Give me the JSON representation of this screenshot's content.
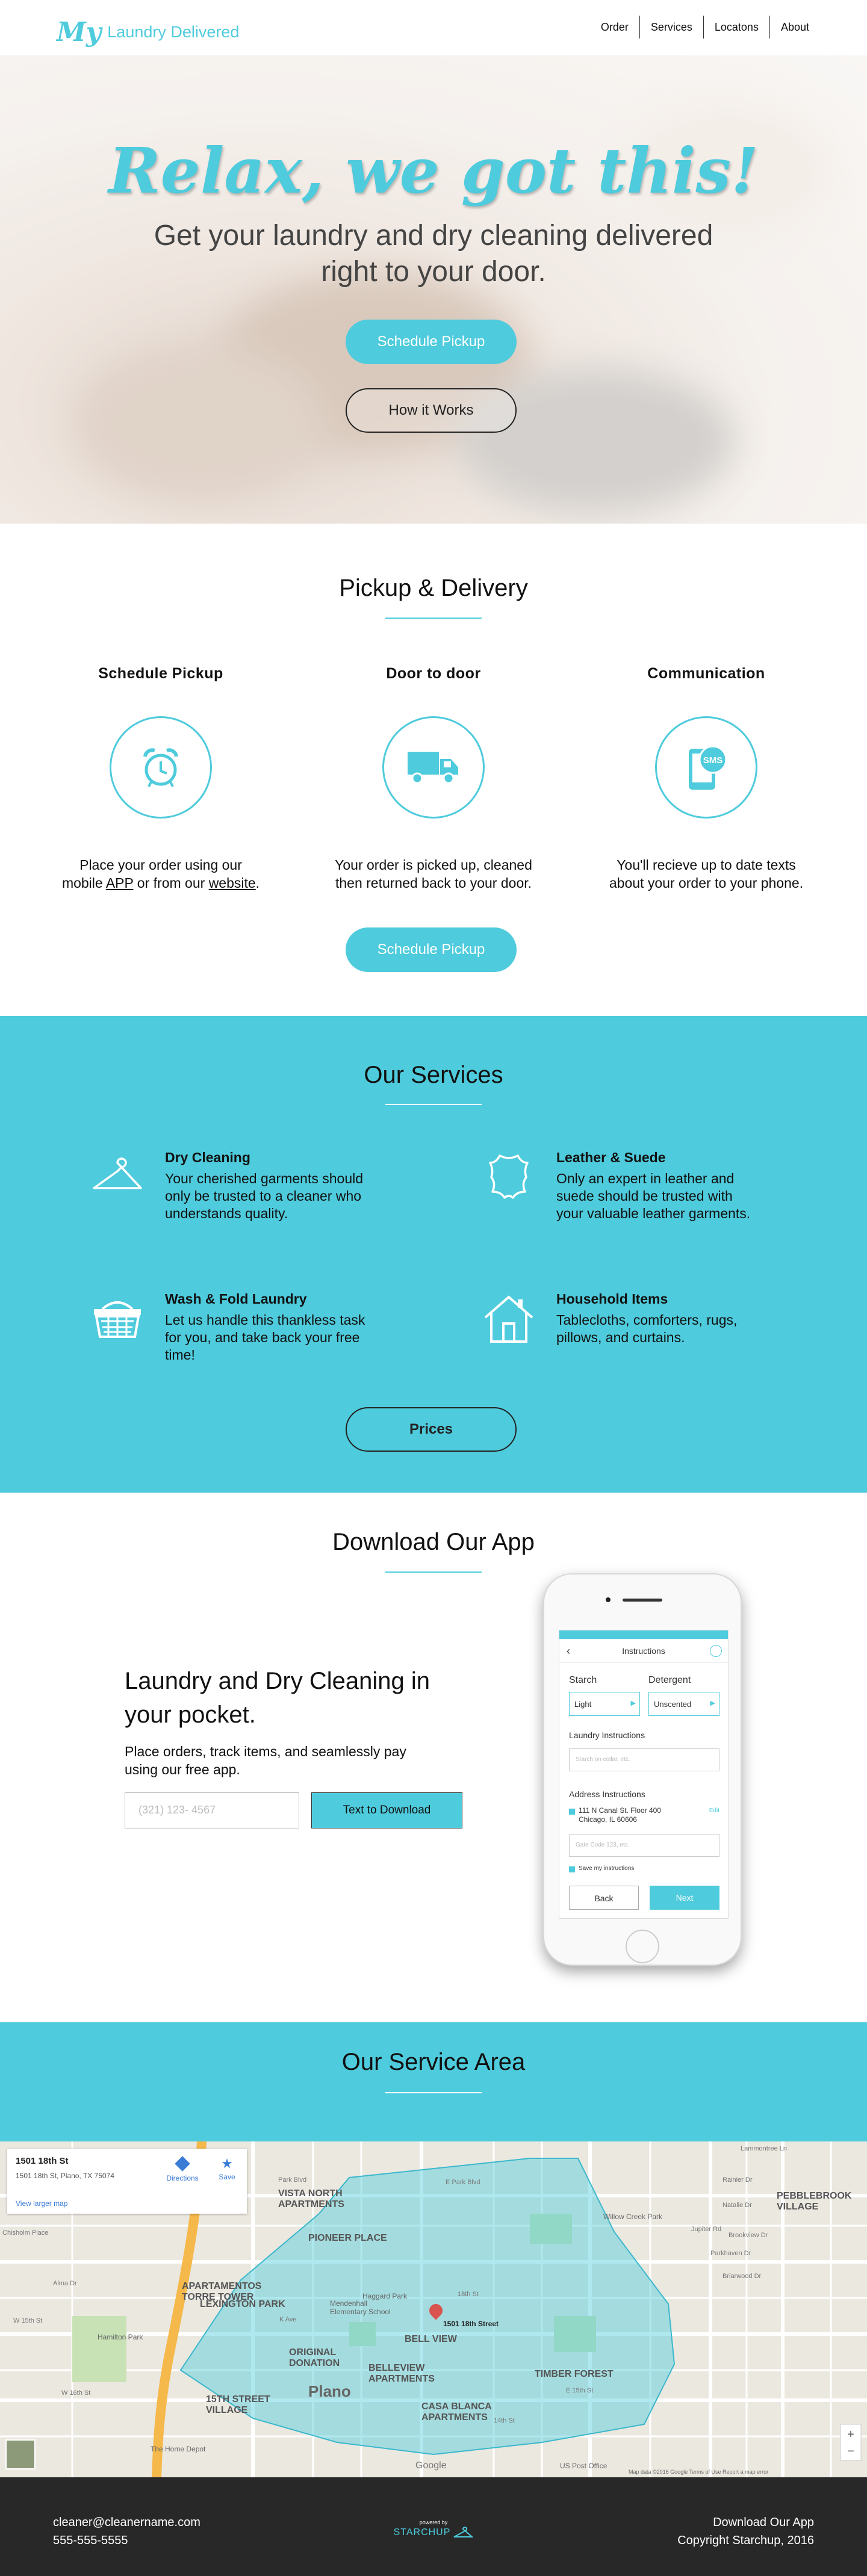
{
  "nav": {
    "logo_my": "My",
    "logo_text": "Laundry Delivered",
    "links": [
      "Order",
      "Services",
      "Locatons",
      "About"
    ]
  },
  "hero": {
    "title": "Relax, we got this!",
    "subtitle_line1": "Get your laundry and dry cleaning delivered",
    "subtitle_line2": "right to your door.",
    "primary_button": "Schedule Pickup",
    "secondary_button": "How it Works"
  },
  "pickup": {
    "title": "Pickup & Delivery",
    "columns": [
      {
        "heading": "Schedule Pickup",
        "icon": "alarm-clock-icon",
        "text_a": "Place your order using our",
        "text_b": "mobile ",
        "link1": "APP",
        "text_c": " or from our ",
        "link2": "website",
        "text_d": "."
      },
      {
        "heading": "Door to door",
        "icon": "delivery-truck-icon",
        "text1": "Your order is picked up, cleaned",
        "text2": "then returned back to your door."
      },
      {
        "heading": "Communication",
        "icon": "sms-phone-icon",
        "icon_label": "SMS",
        "text1": "You'll recieve up to date texts",
        "text2": "about your order to your phone."
      }
    ],
    "button": "Schedule Pickup"
  },
  "services": {
    "title": "Our Services",
    "items": [
      {
        "icon": "hanger-icon",
        "title": "Dry Cleaning",
        "text": "Your cherished garments should only be trusted to a cleaner who understands quality."
      },
      {
        "icon": "leather-hide-icon",
        "title": "Leather & Suede",
        "text": "Only an expert in leather and suede should be trusted with your valuable leather garments."
      },
      {
        "icon": "laundry-basket-icon",
        "title": "Wash & Fold Laundry",
        "text": "Let us handle this thankless task for you, and take back your free time!"
      },
      {
        "icon": "house-icon",
        "title": "Household Items",
        "text": "Tablecloths, comforters, rugs, pillows, and curtains."
      }
    ],
    "button": "Prices"
  },
  "app": {
    "title": "Download Our App",
    "heading_line1": "Laundry and Dry Cleaning in",
    "heading_line2": "your pocket.",
    "text": "Place orders, track items, and seamlessly pay using our free app.",
    "phone_placeholder": "(321) 123- 4567",
    "button": "Text to Download",
    "screen": {
      "header": "Instructions",
      "starch_label": "Starch",
      "starch_value": "Light",
      "detergent_label": "Detergent",
      "detergent_value": "Unscented",
      "laundry_label": "Laundry Instructions",
      "laundry_placeholder": "Starch on collar, etc.",
      "address_label": "Address Instructions",
      "address_line1": "111 N Canal St. Floor 400",
      "address_line2": "Chicago, IL 60606",
      "edit": "Edit",
      "address_placeholder": "Gate Code 123, etc.",
      "save_label": "Save my instructions",
      "back": "Back",
      "next": "Next"
    }
  },
  "area": {
    "title": "Our Service Area",
    "card_title": "1501 18th St",
    "card_address": "1501 18th St, Plano, TX 75074",
    "card_link": "View larger map",
    "directions": "Directions",
    "save": "Save",
    "marker_label": "1501 18th Street",
    "neighborhoods": [
      "VISTA NORTH APARTMENTS",
      "PIONEER PLACE",
      "APARTAMENTOS TORRE TOWER",
      "LEXINGTON PARK",
      "ORIGINAL DONATION",
      "BELL VIEW",
      "BELLEVIEW APARTMENTS",
      "TIMBER FOREST",
      "15TH STREET VILLAGE",
      "CASA BLANCA APARTMENTS",
      "PEBBLEBROOK VILLAGE",
      "Plano"
    ],
    "places": [
      "Mendenhall Elementary School",
      "Haggard Park",
      "Hamilton Park",
      "The Home Depot",
      "US Post Office",
      "Willow Creek Park"
    ],
    "streets": [
      "E Park Blvd",
      "Park Blvd",
      "W 15th St",
      "W 16th St",
      "E 15th St",
      "14th St",
      "18th St",
      "Jupiter Rd",
      "Alma Dr",
      "K Ave",
      "Lammontree Ln",
      "Rainier Dr",
      "Natalie Dr",
      "Brookview Dr",
      "Parkhaven Dr",
      "Briarwood Dr",
      "Chisholm Place"
    ],
    "google": "Google",
    "map_footer": "Map data ©2016 Google  Terms of Use  Report a map error"
  },
  "footer": {
    "email": "cleaner@cleanername.com",
    "phone": "555-555-5555",
    "powered_by": "powered by",
    "brand": "STARCHUP",
    "download": "Download Our App",
    "copyright": "Copyright Starchup, 2016"
  },
  "colors": {
    "accent": "#4ecbdc",
    "footer": "#282828"
  }
}
